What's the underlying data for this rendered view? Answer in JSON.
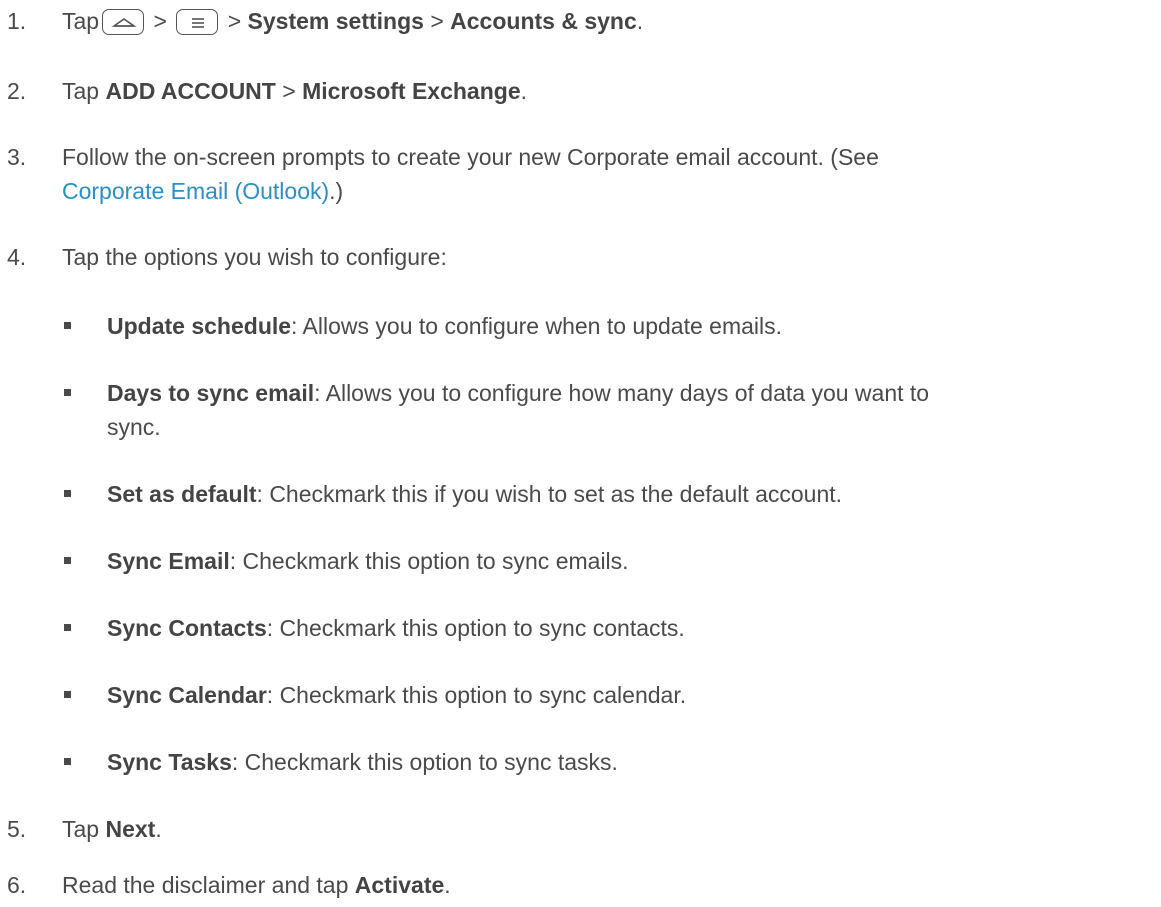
{
  "steps": [
    {
      "num": "1.",
      "tap": "Tap",
      "sep1": ">",
      "sep2": ">",
      "sep3": ">",
      "sep4": ">",
      "system_settings": "System settings",
      "accounts_sync": "Accounts & sync",
      "end": ".",
      "icons": [
        "home-key-icon",
        "menu-key-icon"
      ]
    },
    {
      "num": "2.",
      "tap": "Tap",
      "add_account": "ADD ACCOUNT",
      "sep": ">",
      "exchange": "Microsoft Exchange",
      "end": "."
    },
    {
      "num": "3.",
      "line1": "Follow the on-screen prompts to create your new Corporate email account. (See",
      "link": "Corporate Email (Outlook)",
      "end": ".)"
    },
    {
      "num": "4.",
      "text": "Tap the options you wish to configure:"
    },
    {
      "num": "5.",
      "tap": "Tap",
      "next": "Next",
      "end": "."
    },
    {
      "num": "6.",
      "text": "Read the disclaimer and tap",
      "activate": "Activate",
      "end": "."
    }
  ],
  "options": [
    {
      "label": "Update schedule",
      "desc": ": Allows you to configure when to update emails."
    },
    {
      "label": "Days to sync email",
      "desc": ": Allows you to configure how many days of data you want to",
      "desc2": "sync."
    },
    {
      "label": "Set as default",
      "desc": ": Checkmark this if you wish to set as the default account."
    },
    {
      "label": "Sync Email",
      "desc": ": Checkmark this option to sync emails."
    },
    {
      "label": "Sync Contacts",
      "desc": ": Checkmark this option to sync contacts."
    },
    {
      "label": "Sync Calendar",
      "desc": ": Checkmark this option to sync calendar."
    },
    {
      "label": "Sync Tasks",
      "desc": ": Checkmark this option to sync tasks."
    }
  ],
  "colors": {
    "text": "#4a4a4a",
    "link": "#2b8fc6"
  }
}
